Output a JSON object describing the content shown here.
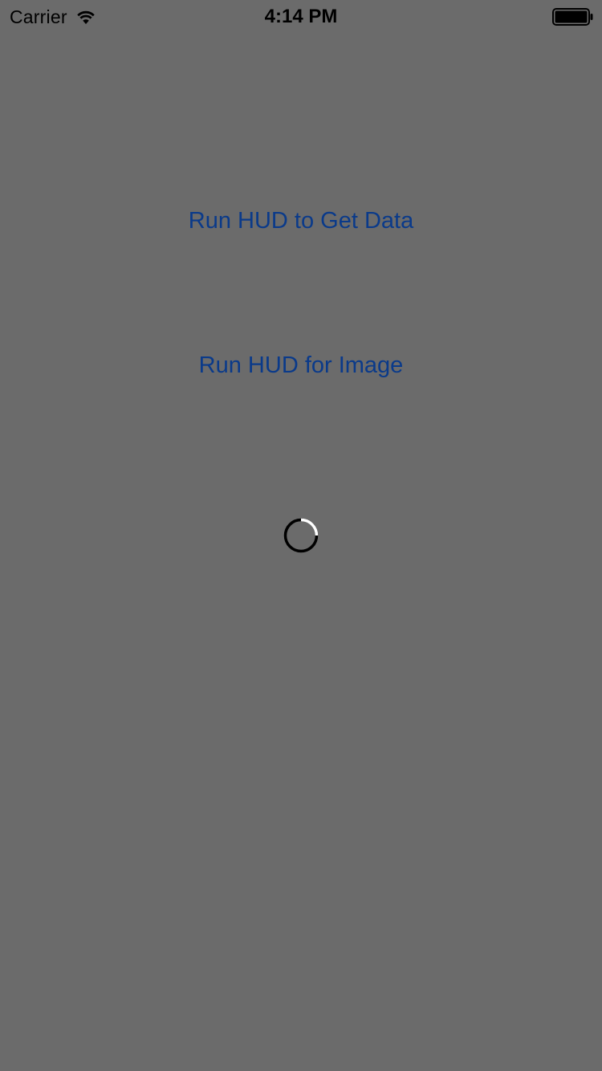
{
  "status_bar": {
    "carrier": "Carrier",
    "time": "4:14 PM",
    "wifi_icon": "wifi-icon",
    "battery_icon": "battery-icon"
  },
  "actions": {
    "get_data_label": "Run HUD to Get Data",
    "image_label": "Run HUD for Image"
  },
  "hud": {
    "indicator": "activity-spinner-icon"
  },
  "colors": {
    "background": "#6b6b6b",
    "button_text": "#0a3a8a",
    "status_text": "#000000"
  }
}
